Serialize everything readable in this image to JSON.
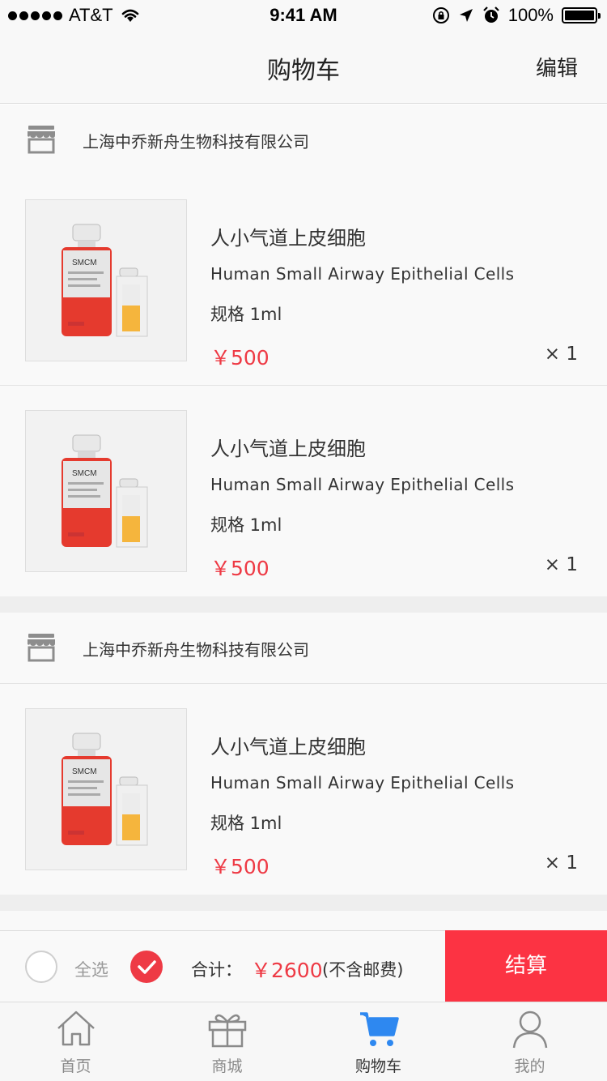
{
  "status_bar": {
    "carrier": "AT&T",
    "time": "9:41 AM",
    "battery": "100%"
  },
  "nav": {
    "title": "购物车",
    "edit": "编辑"
  },
  "shops": [
    {
      "name": "上海中乔新舟生物科技有限公司",
      "items": [
        {
          "name_cn": "人小气道上皮细胞",
          "name_en": "Human Small Airway Epithelial Cells",
          "spec": "规格  1ml",
          "price": "￥500",
          "qty": "× 1"
        },
        {
          "name_cn": "人小气道上皮细胞",
          "name_en": "Human Small Airway Epithelial Cells",
          "spec": "规格  1ml",
          "price": "￥500",
          "qty": "× 1"
        }
      ]
    },
    {
      "name": "上海中乔新舟生物科技有限公司",
      "items": [
        {
          "name_cn": "人小气道上皮细胞",
          "name_en": "Human Small Airway Epithelial Cells",
          "spec": "规格  1ml",
          "price": "￥500",
          "qty": "× 1"
        }
      ]
    }
  ],
  "product_image": {
    "bottle_label": "SMCM"
  },
  "checkout": {
    "select_all": "全选",
    "total_label": "合计：",
    "total_price": "￥2600",
    "total_note": "(不含邮费)",
    "pay_button": "结算"
  },
  "tabs": [
    {
      "label": "首页",
      "icon": "home-icon"
    },
    {
      "label": "商城",
      "icon": "gift-icon"
    },
    {
      "label": "购物车",
      "icon": "cart-icon",
      "active": true
    },
    {
      "label": "我的",
      "icon": "user-icon"
    }
  ],
  "colors": {
    "accent_red": "#fc3343",
    "price_red": "#ee3a45",
    "active_tab_blue": "#2e88f0"
  }
}
